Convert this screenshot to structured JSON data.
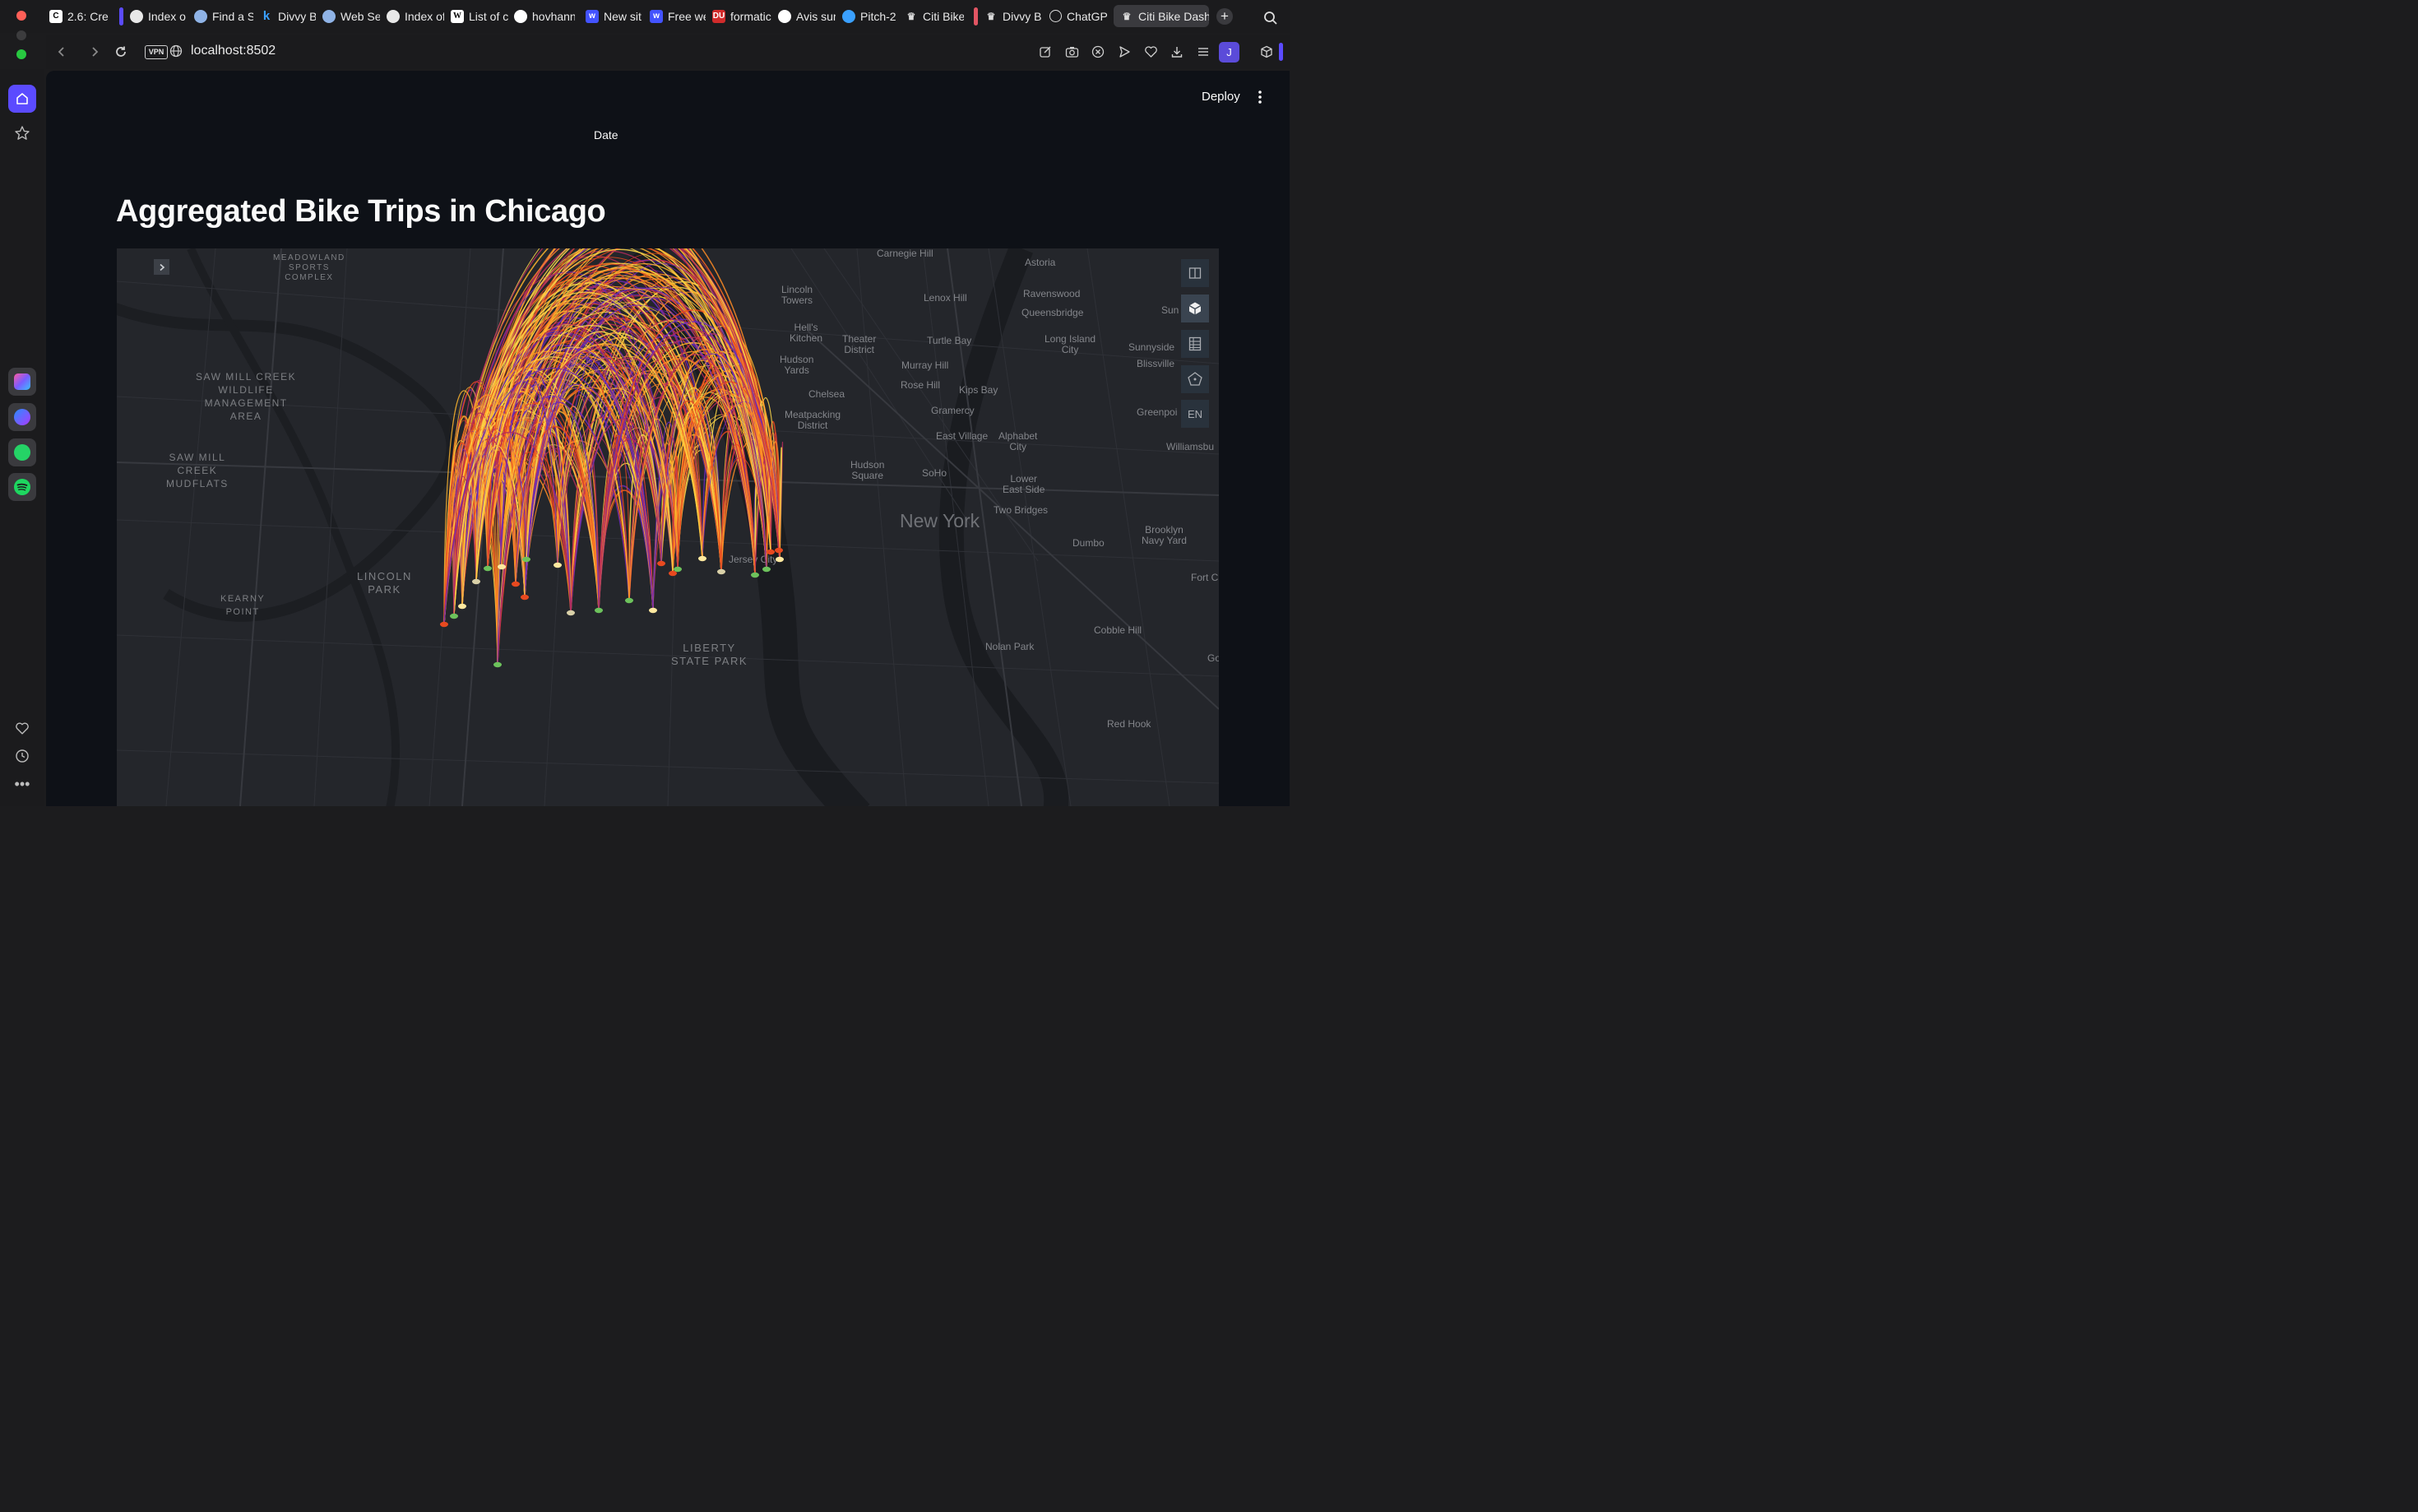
{
  "browser": {
    "tabs": [
      {
        "label": "2.6: Cre",
        "icon": "cf-favicon"
      },
      {
        "label": "Index o",
        "icon": "globe-favicon"
      },
      {
        "label": "Find a S",
        "icon": "noaa-favicon"
      },
      {
        "label": "Divvy B",
        "icon": "k-favicon"
      },
      {
        "label": "Web Se",
        "icon": "noaa-favicon"
      },
      {
        "label": "Index of",
        "icon": "globe-favicon"
      },
      {
        "label": "List of c",
        "icon": "wikipedia-favicon"
      },
      {
        "label": "hovhann",
        "icon": "github-favicon"
      },
      {
        "label": "New sit",
        "icon": "webflow-favicon"
      },
      {
        "label": "Free we",
        "icon": "webflow-favicon"
      },
      {
        "label": "formatic",
        "icon": "du-favicon"
      },
      {
        "label": "Avis sur",
        "icon": "avis-favicon"
      },
      {
        "label": "Pitch-2",
        "icon": "pitch-favicon"
      },
      {
        "label": "Citi Bike",
        "icon": "streamlit-crown-favicon"
      },
      {
        "label": "Divvy B",
        "icon": "streamlit-crown-favicon"
      },
      {
        "label": "ChatGP",
        "icon": "openai-favicon"
      },
      {
        "label": "Citi Bike Dash",
        "icon": "streamlit-crown-favicon",
        "active": true
      }
    ],
    "address": "localhost:8502",
    "vpn_label": "VPN",
    "profile_initial": "J",
    "accent_color": "#5b4bff"
  },
  "app": {
    "deploy_label": "Deploy",
    "date_label": "Date",
    "title": "Aggregated Bike Trips in Chicago"
  },
  "map": {
    "locale_label": "EN",
    "controls": [
      "split-map-icon",
      "3d-view-icon",
      "data-table-icon",
      "map-legend-icon"
    ],
    "arc_colors": [
      "#ffd94a",
      "#ffb62e",
      "#ff8c25",
      "#e8491f",
      "#b52c5a",
      "#6a2ab8"
    ],
    "labels": {
      "meadowland": "MEADOWLAND\nSPORTS\nCOMPLEX",
      "saw_mill_wildlife": "SAW MILL CREEK\nWILDLIFE\nMANAGEMENT\nAREA",
      "saw_mill_mudflats": "SAW MILL\nCREEK\nMUDFLATS",
      "lincoln_park": "LINCOLN\nPARK",
      "kearny_point": "KEARNY\nPOINT",
      "liberty_state_park": "LIBERTY\nSTATE PARK",
      "carnegie_hill": "Carnegie Hill",
      "astoria": "Astoria",
      "lincoln_towers": "Lincoln\nTowers",
      "lenox_hill": "Lenox Hill",
      "ravenswood": "Ravenswood",
      "queensbridge": "Queensbridge",
      "sun": "Sun",
      "hells_kitchen": "Hell's\nKitchen",
      "theater_district": "Theater\nDistrict",
      "turtle_bay": "Turtle Bay",
      "long_island_city": "Long Island\nCity",
      "sunnyside": "Sunnyside",
      "hudson_yards": "Hudson\nYards",
      "murray_hill": "Murray Hill",
      "blissville": "Blissville",
      "rose_hill": "Rose Hill",
      "kips_bay": "Kips Bay",
      "chelsea": "Chelsea",
      "gramercy": "Gramercy",
      "greenpoint": "Greenpoi",
      "meatpacking": "Meatpacking\nDistrict",
      "east_village": "East Village",
      "alphabet_city": "Alphabet\nCity",
      "williamsburg": "Williamsbu",
      "hudson_square": "Hudson\nSquare",
      "soho": "SoHo",
      "lower_east_side": "Lower\nEast Side",
      "new_york": "New York",
      "two_bridges": "Two Bridges",
      "dumbo": "Dumbo",
      "brooklyn_navy_yard": "Brooklyn\nNavy Yard",
      "fort": "Fort C",
      "jersey_city": "Jersey City",
      "nolan_park": "Nolan Park",
      "cobble_hill": "Cobble Hill",
      "go": "Go",
      "red_hook": "Red Hook"
    }
  }
}
